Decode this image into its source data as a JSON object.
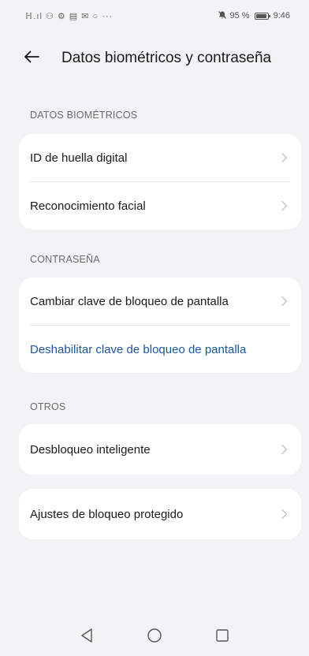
{
  "status_bar": {
    "left_icons": "ℍ.ıl ⚇ ⚙ ▤ ✉ ○ ···",
    "battery_percent": "95 %",
    "time": "9:46"
  },
  "header": {
    "title": "Datos biométricos y contraseña"
  },
  "sections": {
    "biometric": {
      "label": "DATOS BIOMÉTRICOS",
      "items": [
        "ID de huella digital",
        "Reconocimiento facial"
      ]
    },
    "password": {
      "label": "CONTRASEÑA",
      "items": [
        "Cambiar clave de bloqueo de pantalla",
        "Deshabilitar clave de bloqueo de pantalla"
      ]
    },
    "others": {
      "label": "OTROS",
      "items": [
        "Desbloqueo inteligente",
        "Ajustes de bloqueo protegido"
      ]
    }
  },
  "colors": {
    "background": "#f1f3f5",
    "card": "#ffffff",
    "link": "#1a56a8",
    "section_label": "#6b6b6b"
  }
}
